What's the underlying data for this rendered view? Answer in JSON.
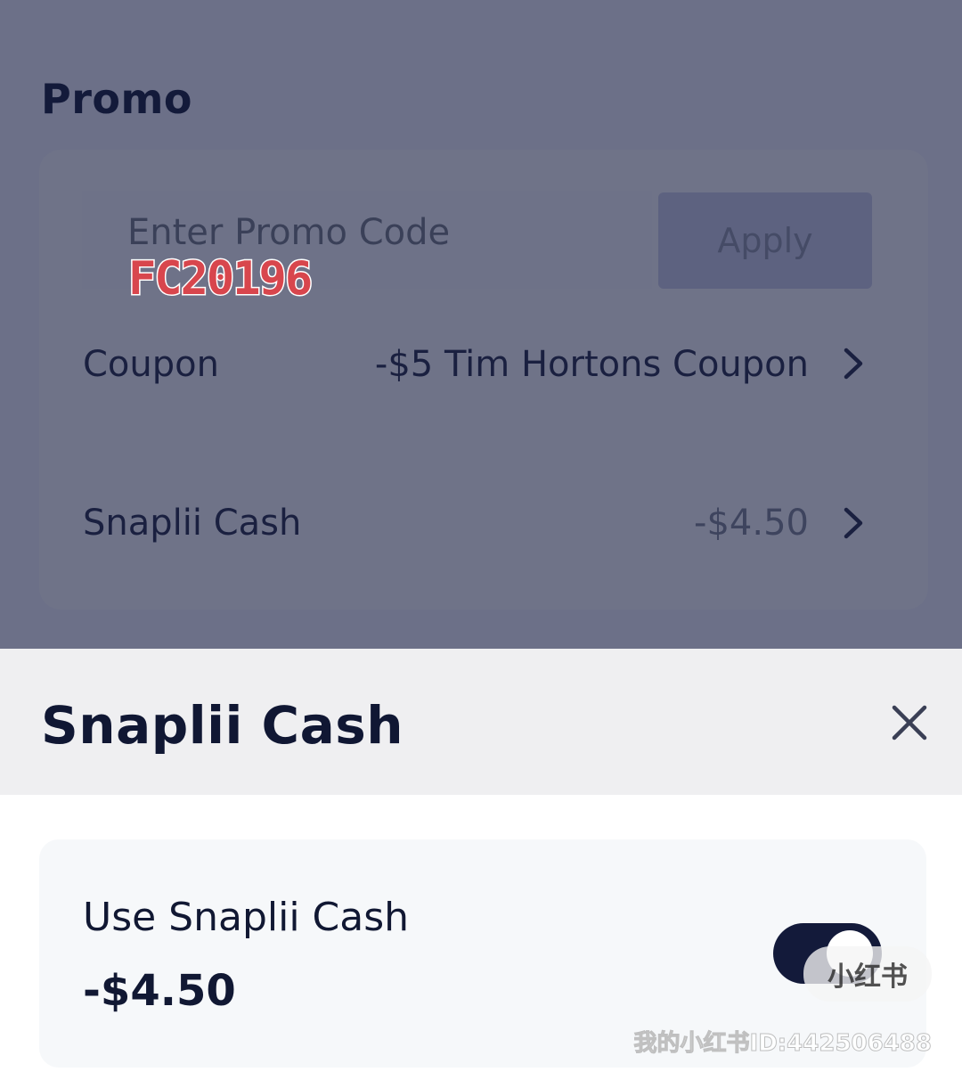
{
  "promo": {
    "heading": "Promo",
    "input_placeholder": "Enter Promo Code",
    "sticker_code": "FC20196",
    "apply_label": "Apply"
  },
  "rows": [
    {
      "label": "Coupon",
      "value": "-$5 Tim Hortons Coupon",
      "icon": "chevron-right-icon"
    },
    {
      "label": "Snaplii Cash",
      "value": "-$4.50",
      "icon": "chevron-right-icon"
    }
  ],
  "sheet": {
    "title": "Snaplii Cash",
    "close_icon": "close-icon",
    "card": {
      "label": "Use Snaplii Cash",
      "amount": "-$4.50",
      "toggle_on": true
    }
  },
  "watermark": {
    "badge": "小红书",
    "text": "我的小红书ID:442506488"
  },
  "colors": {
    "overlay": "#6c7088",
    "navy": "#131a3a",
    "sheet_header": "#efeff1",
    "card_bg": "#f6f8fa",
    "sticker_red": "#d8464d"
  }
}
